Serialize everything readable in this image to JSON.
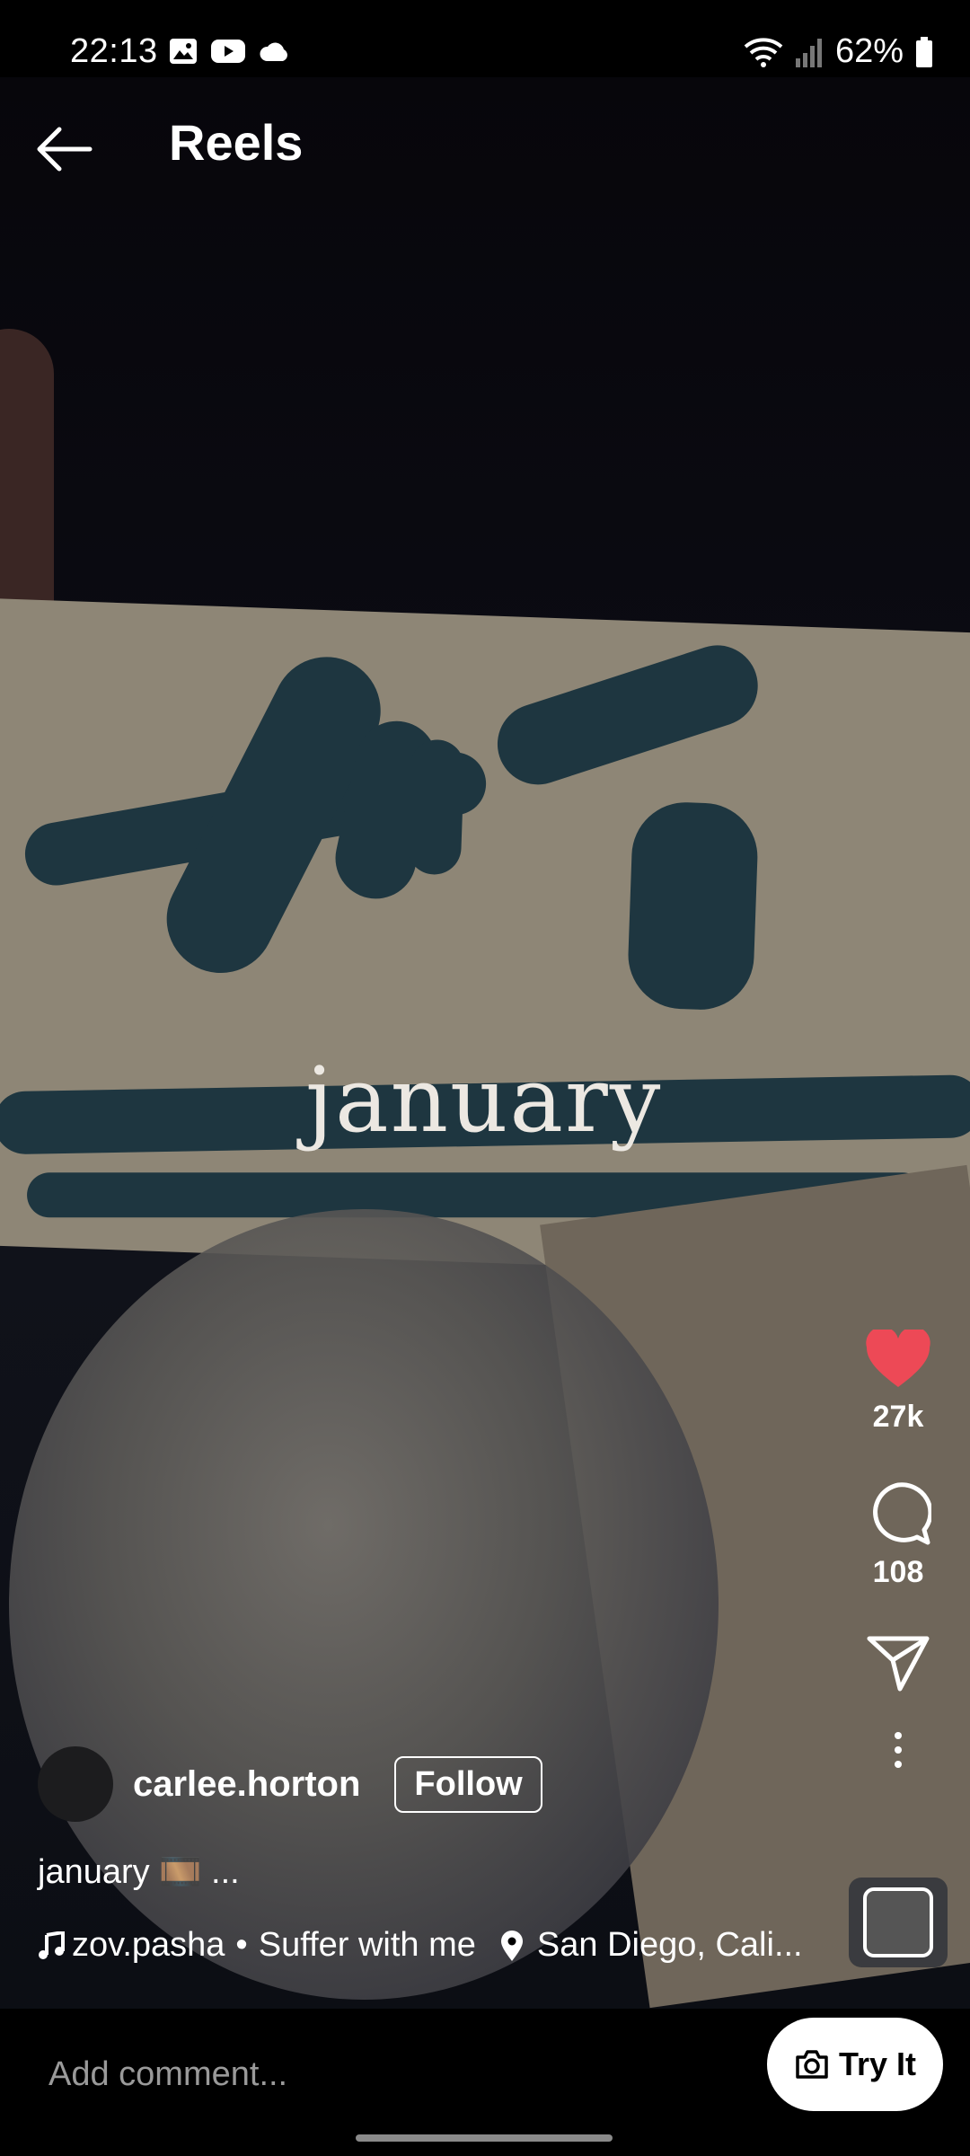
{
  "status_bar": {
    "time": "22:13",
    "battery": "62%"
  },
  "header": {
    "title": "Reels"
  },
  "video": {
    "overlay_text": "january"
  },
  "actions": {
    "likes": "27k",
    "comments": "108",
    "like_color": "#ed4956"
  },
  "post": {
    "username": "carlee.horton",
    "follow_label": "Follow",
    "caption": "january 🎞️ ...",
    "audio": "zov.pasha",
    "song": "Suffer with me",
    "location": "San Diego, Cali..."
  },
  "comment_bar": {
    "placeholder": "Add comment...",
    "try_it_label": "Try It"
  }
}
